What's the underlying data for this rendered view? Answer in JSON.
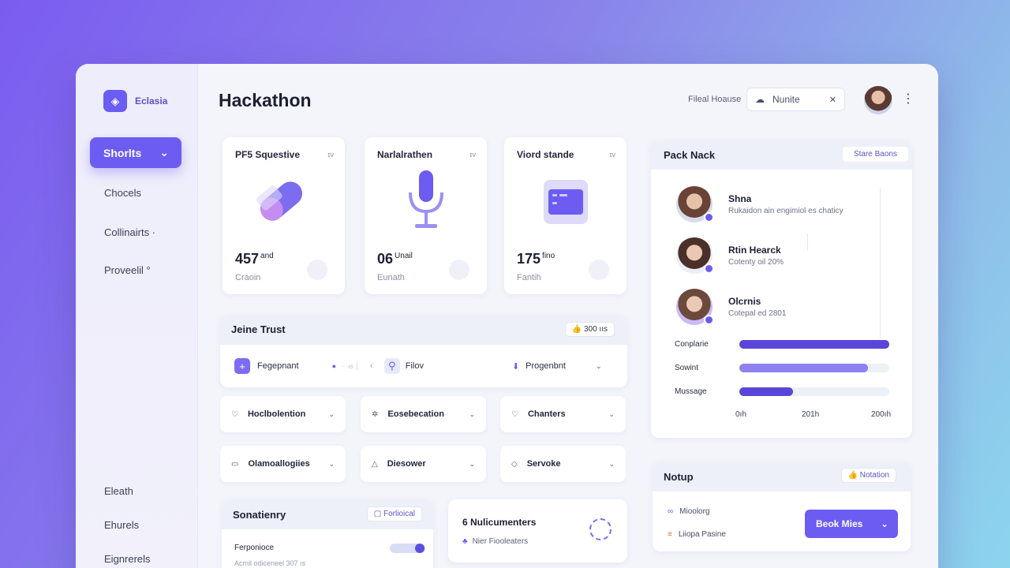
{
  "brand": {
    "name": "Eclasia"
  },
  "sidebar": {
    "active": "Shorlts",
    "items": [
      "Chocels",
      "Collinairts ·",
      "Proveelil °"
    ],
    "bottom": [
      "Eleath",
      "Ehurels",
      "Eignrerels"
    ]
  },
  "header": {
    "title": "Hackathon",
    "label": "Fileal Hoause",
    "search_value": "Nunite"
  },
  "stats": [
    {
      "title": "PF5 Squestive",
      "mark": "ɪv",
      "value": "457",
      "unit": "and",
      "sub": "Craoin",
      "icon": "capsule-icon"
    },
    {
      "title": "Narlalrathen",
      "mark": "ɪv",
      "value": "06",
      "unit": "Unail",
      "sub": "Eunath",
      "icon": "microphone-icon"
    },
    {
      "title": "Viord stande",
      "mark": "ɪv",
      "value": "175",
      "unit": "fino",
      "sub": "Fantih",
      "icon": "card-icon"
    }
  ],
  "trust": {
    "title": "Jeine Trust",
    "badge": "300 ııs",
    "row": {
      "left": "Fegepnant",
      "middle": "Filov",
      "right": "Progenbnt"
    }
  },
  "dropdowns": [
    {
      "label": "Hoclbolention",
      "icon": "pin-icon"
    },
    {
      "label": "Eosebecation",
      "icon": "sparkle-icon"
    },
    {
      "label": "Chanters",
      "icon": "heart-icon"
    },
    {
      "label": "Olamoallogiies",
      "icon": "message-icon"
    },
    {
      "label": "Diesower",
      "icon": "drop-icon"
    },
    {
      "label": "Servoke",
      "icon": "shield-icon"
    }
  ],
  "pack": {
    "title": "Pack Nack",
    "button": "Stare Baons",
    "people": [
      {
        "name": "Shna",
        "sub": "Rukaidon ain engimiol es chaticy"
      },
      {
        "name": "Rtin Hearck",
        "sub": "Cotenty oil 20%"
      },
      {
        "name": "Olcrnis",
        "sub": "Cotepal ed 2801"
      }
    ],
    "bars": [
      {
        "label": "Conplarie",
        "value": 1.0,
        "color": "#5b45d9"
      },
      {
        "label": "Sowint",
        "value": 0.86,
        "color": "#8f82ef"
      },
      {
        "label": "Mussage",
        "value": 0.36,
        "color": "#5b45d9"
      }
    ],
    "ticks": [
      "0ıh",
      "201h",
      "200ıh"
    ]
  },
  "notup": {
    "title": "Notup",
    "button": "Notation",
    "items": [
      "Mioolorg",
      "Liiopa Pasine"
    ],
    "action": "Beok Mies"
  },
  "sona": {
    "title": "Sonatienry",
    "button": "Forlioical",
    "label": "Ferponioce",
    "sub": "Acmil odiceneel 307 ıs"
  },
  "nuli": {
    "title": "6 Nulicumenters",
    "sub": "Nier Fiooleaters"
  }
}
